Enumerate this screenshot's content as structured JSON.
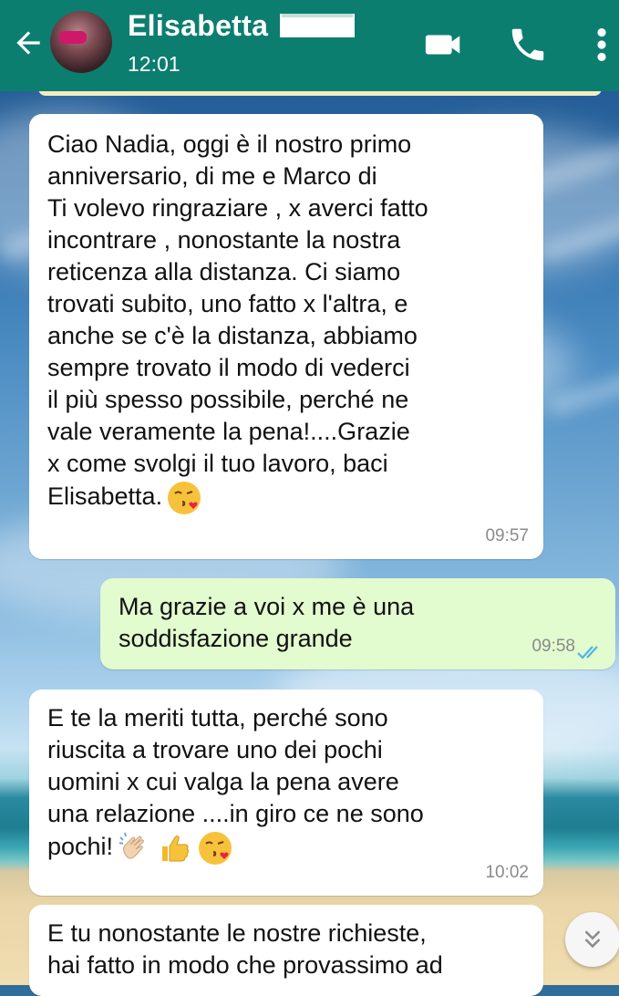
{
  "header": {
    "contact_name": "Elisabetta",
    "last_seen": "12:01"
  },
  "icons": {
    "back": "arrow-left-icon",
    "video": "video-call-icon",
    "phone": "voice-call-icon",
    "menu": "more-vertical-icon",
    "scroll": "chevron-double-down-icon"
  },
  "colors": {
    "header": "#0c7e6f",
    "incoming_bubble": "#ffffff",
    "outgoing_bubble": "#e2fbcf",
    "read_ticks": "#4fb4e6"
  },
  "messages": [
    {
      "direction": "incoming",
      "text": "Ciao Nadia, oggi è il nostro primo\nanniversario, di me e Marco di\nTi volevo ringraziare , x averci fatto\nincontrare , nonostante la nostra\nreticenza alla distanza. Ci siamo\ntrovati subito, uno fatto x l'altra, e\nanche se c'è la distanza, abbiamo\nsempre trovato il modo di vederci\nil più spesso possibile, perché ne\nvale veramente la pena!....Grazie\nx come svolgi il tuo lavoro, baci\nElisabetta.",
      "emojis": [
        "kiss-face-emoji"
      ],
      "time": "09:57"
    },
    {
      "direction": "outgoing",
      "text": "Ma grazie a voi x me è una\nsoddisfazione grande",
      "time": "09:58",
      "status": "read"
    },
    {
      "direction": "incoming",
      "text": "E te la meriti tutta, perché sono\nriuscita a trovare uno dei pochi\nuomini x cui valga la pena avere\nuna relazione ....in giro ce ne sono\npochi!",
      "emojis": [
        "clapping-hands-emoji",
        "thumbs-up-emoji",
        "kiss-face-emoji"
      ],
      "time": "10:02"
    },
    {
      "direction": "incoming",
      "text": "E tu nonostante le nostre richieste,\nhai fatto in modo che provassimo ad"
    }
  ]
}
